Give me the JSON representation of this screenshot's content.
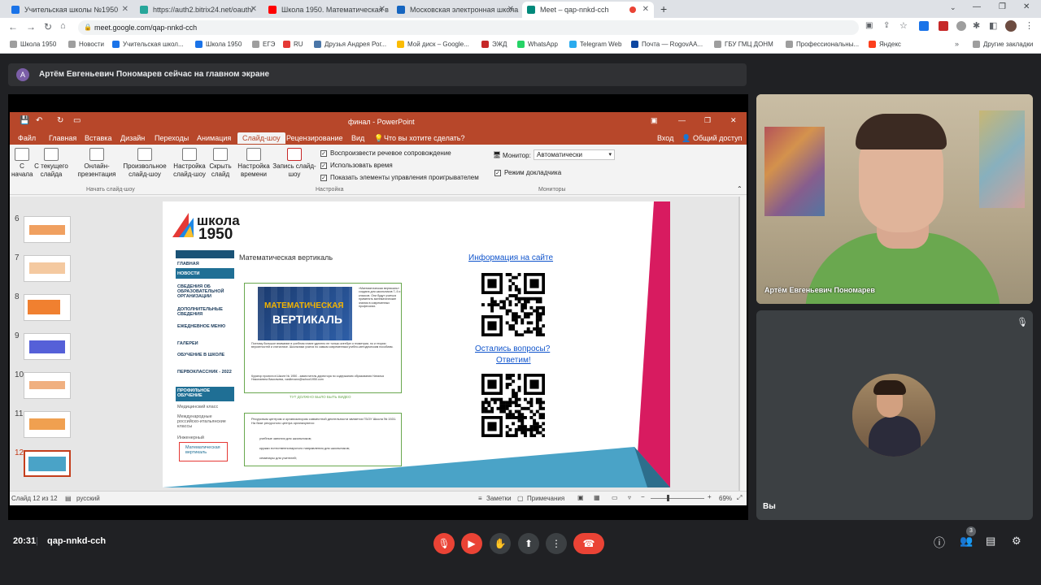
{
  "tabs": [
    {
      "label": "Учительская школы №1950",
      "color": "#1a73e8",
      "active": false
    },
    {
      "label": "https://auth2.bitrix24.net/oauth/",
      "color": "#26a69a",
      "active": false
    },
    {
      "label": "Школа 1950. Математическая в",
      "color": "#ff0000",
      "active": false
    },
    {
      "label": "Московская электронная школа",
      "color": "#1565c0",
      "active": false
    },
    {
      "label": "Meet – qap-nnkd-cch",
      "color": "#00897b",
      "active": true
    }
  ],
  "address": {
    "url": "meet.google.com/qap-nnkd-cch"
  },
  "bookmarks": [
    {
      "label": "Школа 1950",
      "color": "#9e9e9e"
    },
    {
      "label": "Новости",
      "color": "#9e9e9e"
    },
    {
      "label": "Учительская школ...",
      "color": "#1a73e8"
    },
    {
      "label": "Школа 1950",
      "color": "#1a73e8"
    },
    {
      "label": "ЕГЭ",
      "color": "#9e9e9e"
    },
    {
      "label": "RU",
      "color": "#e53935"
    },
    {
      "label": "Друзья Андрея Рог...",
      "color": "#4a76a8"
    },
    {
      "label": "Мой диск – Google...",
      "color": "#fbbc04"
    },
    {
      "label": "ЭЖД",
      "color": "#c62828"
    },
    {
      "label": "WhatsApp",
      "color": "#25d366"
    },
    {
      "label": "Telegram Web",
      "color": "#2aabee"
    },
    {
      "label": "Почта — RogovAA...",
      "color": "#0d47a1"
    },
    {
      "label": "ГБУ ГМЦ ДОНМ",
      "color": "#9e9e9e"
    },
    {
      "label": "Профессиональны...",
      "color": "#9e9e9e"
    },
    {
      "label": "Яндекс",
      "color": "#fc3f1d"
    }
  ],
  "bookmarks_other": "Другие закладки",
  "notice": {
    "avatar_letter": "А",
    "text": "Артём Евгеньевич Пономарев сейчас на главном экране"
  },
  "ppt": {
    "title": "финал - PowerPoint",
    "menu": [
      "Файл",
      "Главная",
      "Вставка",
      "Дизайн",
      "Переходы",
      "Анимация",
      "Слайд-шоу",
      "Рецензирование",
      "Вид"
    ],
    "tell_me": "Что вы хотите сделать?",
    "signin": "Вход",
    "share": "Общий доступ",
    "ribbon_buttons": [
      "С начала",
      "С текущего слайда",
      "Онлайн-презентация",
      "Произвольное слайд-шоу",
      "Настройка слайд-шоу",
      "Скрыть слайд",
      "Настройка времени",
      "Запись слайд-шоу"
    ],
    "checks": [
      "Воспроизвести речевое сопровождение",
      "Использовать время",
      "Показать элементы управления проигрывателем"
    ],
    "monitor_label": "Монитор:",
    "monitor_value": "Автоматически",
    "presenter_view": "Режим докладчика",
    "groups": [
      "Начать слайд-шоу",
      "Настройка",
      "Мониторы"
    ],
    "thumb_numbers": [
      "6",
      "7",
      "8",
      "9",
      "10",
      "11",
      "12"
    ],
    "status_slide": "Слайд 12 из 12",
    "status_lang": "русский",
    "status_notes": "Заметки",
    "status_comments": "Примечания",
    "zoom": "69%"
  },
  "slide": {
    "logo_top": "школа",
    "logo_num": "1950",
    "nav": [
      "ГЛАВНАЯ",
      "НОВОСТИ",
      "СВЕДЕНИЯ ОБ ОБРАЗОВАТЕЛЬНОЙ ОРГАНИЗАЦИИ",
      "ДОПОЛНИТЕЛЬНЫЕ СВЕДЕНИЯ",
      "ЕЖЕДНЕВНОЕ МЕНЮ",
      "ГАЛЕРЕИ",
      "ОБУЧЕНИЕ В ШКОЛЕ",
      "ПЕРВОКЛАССНИК - 2022",
      "ПРОФИЛЬНОЕ ОБУЧЕНИЕ",
      "Медицинский класс",
      "Международные российско-итальянские классы",
      "Инженерный",
      "Математическая вертикаль"
    ],
    "page_title": "Математическая вертикаль",
    "banner_line1": "МАТЕМАТИЧЕСКАЯ",
    "banner_line2": "ВЕРТИКАЛЬ",
    "side_text": "«Математическая вертикаль» создана для школьников 7–9-х классов. Они будут учиться применять математические знания в современных профессиях.",
    "body_text": "Поэтому большое внимание в учебном плане уделено не только алгебре и геометрии, но и теории вероятностей и статистике. Школьники учатся по самым современным учебно-методическим пособиям.",
    "curator": "Куратор проекта в Школе № 1950 - заместитель директора по содержанию образования Наталья Николаевна Васильева, vasilievann@school1950.com",
    "video_note": "ТУТ ДОЛЖНО БЫЛО БЫТЬ ВИДЕО",
    "resource_text": "Ресурсным центром и организатором совместной деятельности является ГБОУ Школа № 1531. На базе ресурсного центра организуются:",
    "bullets": [
      "учебные занятия для школьников;",
      "кружки естественнонаучного направления для школьников;",
      "семинары для учителей;"
    ],
    "info_link": "Информация на сайте",
    "questions_link_1": "Остались вопросы?",
    "questions_link_2": "Ответим!"
  },
  "participants": {
    "main_name": "Артём Евгеньевич Пономарев",
    "self_name": "Вы"
  },
  "meeting": {
    "time": "20:31",
    "code": "qap-nnkd-cch",
    "people_count": "3"
  },
  "colors": {
    "ppt_accent": "#b7472a",
    "meet_red": "#ea4335",
    "slide_pink": "#d81b60",
    "slide_blue": "#4aa3c7"
  }
}
